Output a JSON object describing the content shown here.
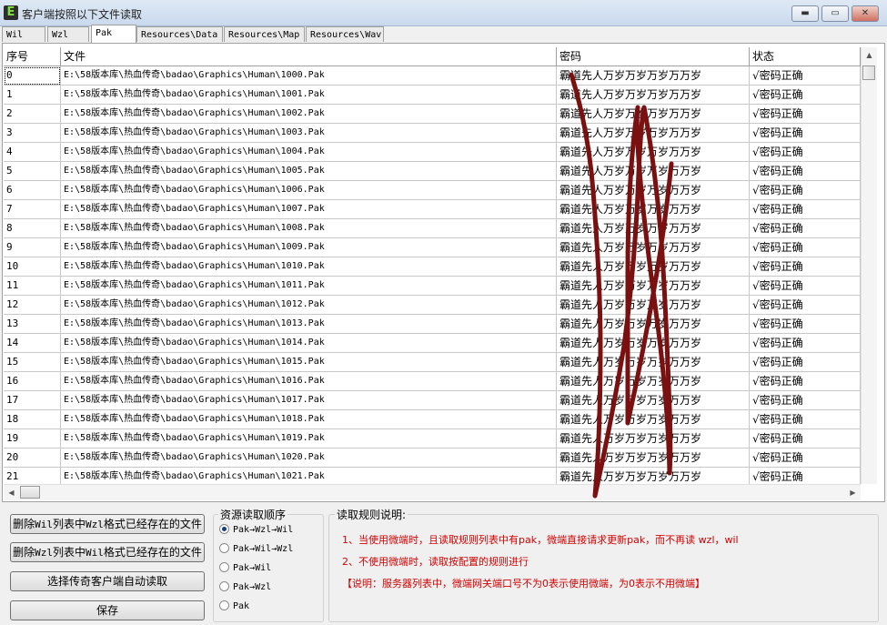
{
  "window": {
    "title": "客户端按照以下文件读取",
    "icon_letter": "E",
    "minimize": "▬",
    "maximize": "▭",
    "close": "✕"
  },
  "tabs": [
    "Wil",
    "Wzl",
    "Pak",
    "Resources\\Data",
    "Resources\\Map",
    "Resources\\Wav"
  ],
  "active_tab": "Pak",
  "table": {
    "columns": [
      "序号",
      "文件",
      "密码",
      "状态"
    ],
    "rows": [
      {
        "id": "0",
        "file": "E:\\58版本库\\热血传奇\\badao\\Graphics\\Human\\1000.Pak",
        "password": "霸道先人万岁万岁万岁万万岁",
        "status": "√密码正确"
      },
      {
        "id": "1",
        "file": "E:\\58版本库\\热血传奇\\badao\\Graphics\\Human\\1001.Pak",
        "password": "霸道先人万岁万岁万岁万万岁",
        "status": "√密码正确"
      },
      {
        "id": "2",
        "file": "E:\\58版本库\\热血传奇\\badao\\Graphics\\Human\\1002.Pak",
        "password": "霸道先人万岁万岁万岁万万岁",
        "status": "√密码正确"
      },
      {
        "id": "3",
        "file": "E:\\58版本库\\热血传奇\\badao\\Graphics\\Human\\1003.Pak",
        "password": "霸道先人万岁万岁万岁万万岁",
        "status": "√密码正确"
      },
      {
        "id": "4",
        "file": "E:\\58版本库\\热血传奇\\badao\\Graphics\\Human\\1004.Pak",
        "password": "霸道先人万岁万岁万岁万万岁",
        "status": "√密码正确"
      },
      {
        "id": "5",
        "file": "E:\\58版本库\\热血传奇\\badao\\Graphics\\Human\\1005.Pak",
        "password": "霸道先人万岁万岁万岁万万岁",
        "status": "√密码正确"
      },
      {
        "id": "6",
        "file": "E:\\58版本库\\热血传奇\\badao\\Graphics\\Human\\1006.Pak",
        "password": "霸道先人万岁万岁万岁万万岁",
        "status": "√密码正确"
      },
      {
        "id": "7",
        "file": "E:\\58版本库\\热血传奇\\badao\\Graphics\\Human\\1007.Pak",
        "password": "霸道先人万岁万岁万岁万万岁",
        "status": "√密码正确"
      },
      {
        "id": "8",
        "file": "E:\\58版本库\\热血传奇\\badao\\Graphics\\Human\\1008.Pak",
        "password": "霸道先人万岁万岁万岁万万岁",
        "status": "√密码正确"
      },
      {
        "id": "9",
        "file": "E:\\58版本库\\热血传奇\\badao\\Graphics\\Human\\1009.Pak",
        "password": "霸道先人万岁万岁万岁万万岁",
        "status": "√密码正确"
      },
      {
        "id": "10",
        "file": "E:\\58版本库\\热血传奇\\badao\\Graphics\\Human\\1010.Pak",
        "password": "霸道先人万岁万岁万岁万万岁",
        "status": "√密码正确"
      },
      {
        "id": "11",
        "file": "E:\\58版本库\\热血传奇\\badao\\Graphics\\Human\\1011.Pak",
        "password": "霸道先人万岁万岁万岁万万岁",
        "status": "√密码正确"
      },
      {
        "id": "12",
        "file": "E:\\58版本库\\热血传奇\\badao\\Graphics\\Human\\1012.Pak",
        "password": "霸道先人万岁万岁万岁万万岁",
        "status": "√密码正确"
      },
      {
        "id": "13",
        "file": "E:\\58版本库\\热血传奇\\badao\\Graphics\\Human\\1013.Pak",
        "password": "霸道先人万岁万岁万岁万万岁",
        "status": "√密码正确"
      },
      {
        "id": "14",
        "file": "E:\\58版本库\\热血传奇\\badao\\Graphics\\Human\\1014.Pak",
        "password": "霸道先人万岁万岁万岁万万岁",
        "status": "√密码正确"
      },
      {
        "id": "15",
        "file": "E:\\58版本库\\热血传奇\\badao\\Graphics\\Human\\1015.Pak",
        "password": "霸道先人万岁万岁万岁万万岁",
        "status": "√密码正确"
      },
      {
        "id": "16",
        "file": "E:\\58版本库\\热血传奇\\badao\\Graphics\\Human\\1016.Pak",
        "password": "霸道先人万岁万岁万岁万万岁",
        "status": "√密码正确"
      },
      {
        "id": "17",
        "file": "E:\\58版本库\\热血传奇\\badao\\Graphics\\Human\\1017.Pak",
        "password": "霸道先人万岁万岁万岁万万岁",
        "status": "√密码正确"
      },
      {
        "id": "18",
        "file": "E:\\58版本库\\热血传奇\\badao\\Graphics\\Human\\1018.Pak",
        "password": "霸道先人万岁万岁万岁万万岁",
        "status": "√密码正确"
      },
      {
        "id": "19",
        "file": "E:\\58版本库\\热血传奇\\badao\\Graphics\\Human\\1019.Pak",
        "password": "霸道先人万岁万岁万岁万万岁",
        "status": "√密码正确"
      },
      {
        "id": "20",
        "file": "E:\\58版本库\\热血传奇\\badao\\Graphics\\Human\\1020.Pak",
        "password": "霸道先人万岁万岁万岁万万岁",
        "status": "√密码正确"
      },
      {
        "id": "21",
        "file": "E:\\58版本库\\热血传奇\\badao\\Graphics\\Human\\1021.Pak",
        "password": "霸道先人万岁万岁万岁万万岁",
        "status": "√密码正确"
      }
    ]
  },
  "buttons": {
    "delete_wil_prefix": "删除",
    "delete_wil_mono": "Wil",
    "delete_wil_mid": "列表中",
    "delete_wil_mono2": "Wzl",
    "delete_wil_suffix": "格式已经存在的文件",
    "delete_wzl_prefix": "删除",
    "delete_wzl_mono": "Wzl",
    "delete_wzl_mid": "列表中",
    "delete_wzl_mono2": "Wil",
    "delete_wzl_suffix": "格式已经存在的文件",
    "auto_read": "选择传奇客户端自动读取",
    "save": "保存"
  },
  "read_order": {
    "title": "资源读取顺序",
    "options": [
      "Pak→Wzl→Wil",
      "Pak→Wil→Wzl",
      "Pak→Wil",
      "Pak→Wzl",
      "Pak"
    ],
    "selected_index": 0
  },
  "rules": {
    "title": "读取规则说明:",
    "lines": [
      "1、当使用微端时，且读取规则列表中有pak，微端直接请求更新pak，而不再读 wzl，wil",
      "2、不使用微端时，读取按配置的规则进行",
      "【说明：服务器列表中，微端网关端口号不为0表示使用微端，为0表示不用微端】"
    ]
  },
  "colors": {
    "annotation_stroke": "#7a1010",
    "rule_text": "#d40000"
  }
}
